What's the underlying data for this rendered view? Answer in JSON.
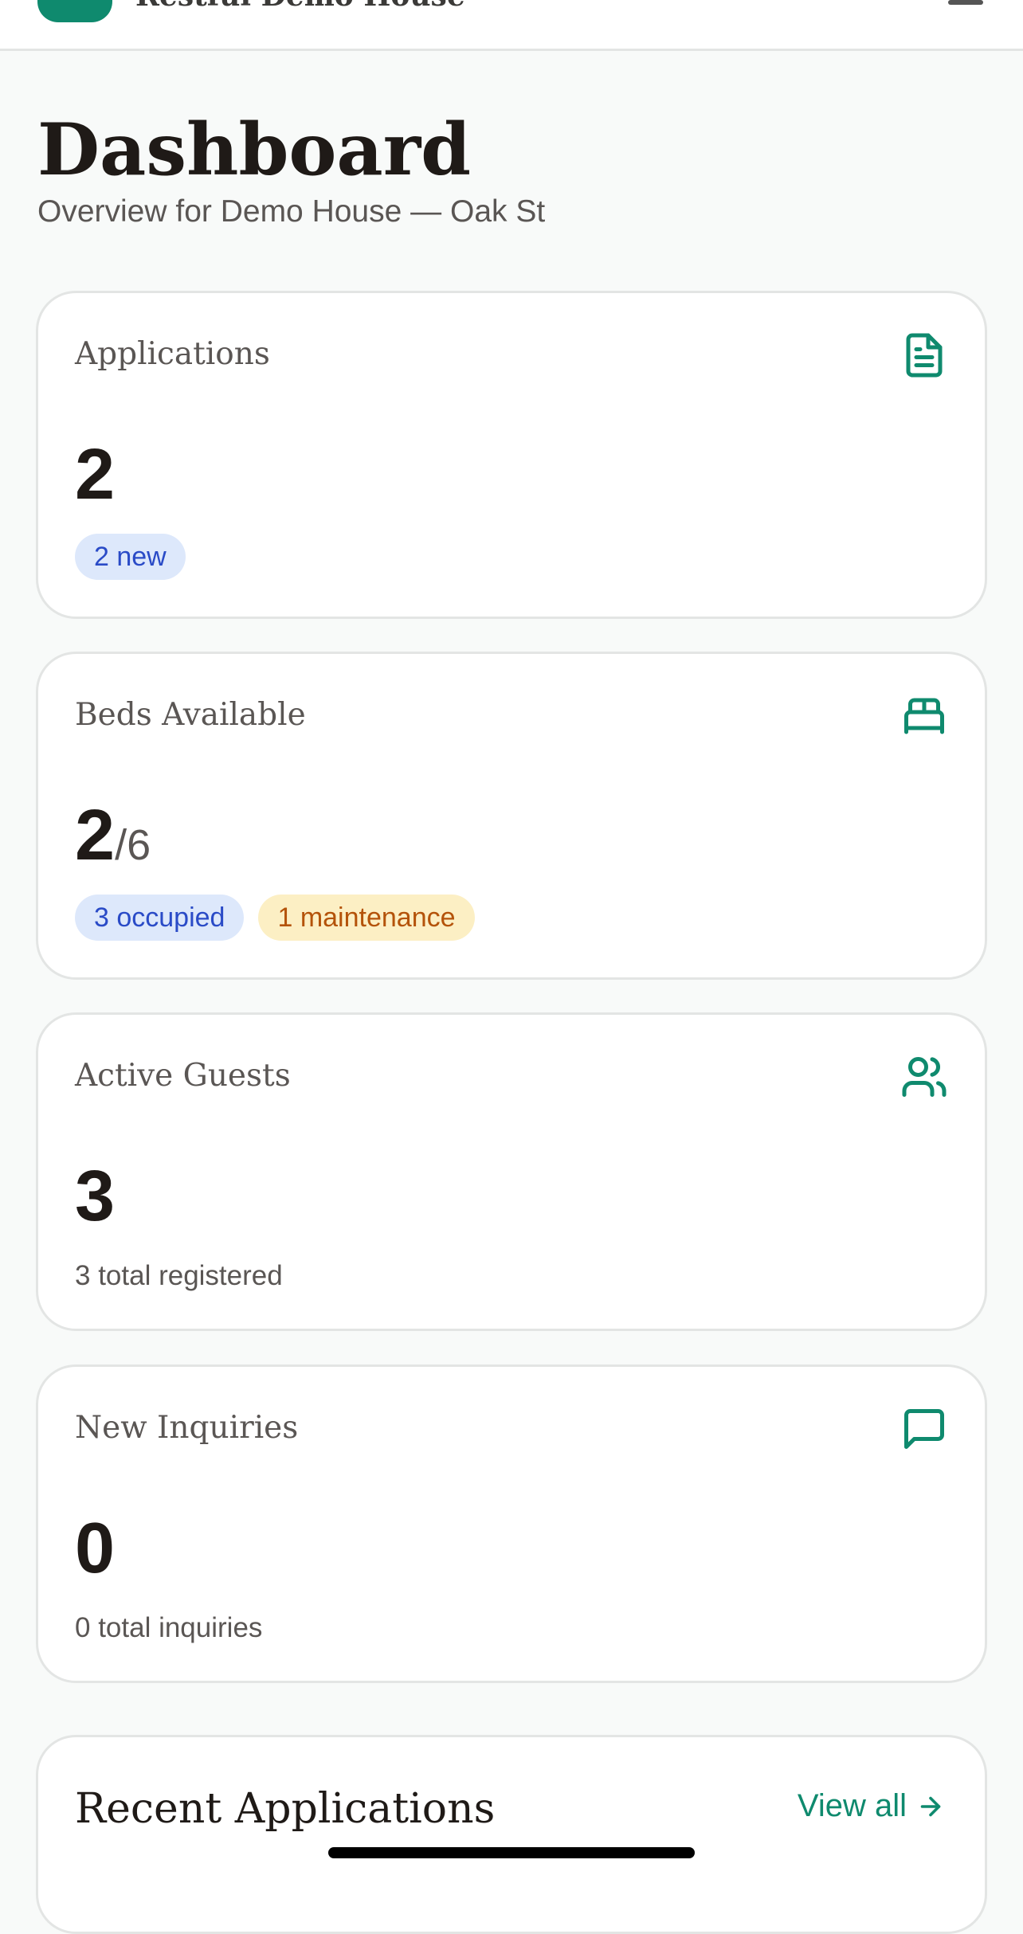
{
  "header": {
    "brand_name": "Restful Demo House",
    "logo_icon": "house-logo-icon",
    "menu_icon": "menu-icon"
  },
  "page": {
    "title": "Dashboard",
    "subtitle": "Overview for Demo House — Oak St"
  },
  "colors": {
    "accent": "#0f8a6e",
    "badge_blue_bg": "#dde8fb",
    "badge_blue_text": "#2a4bc7",
    "badge_amber_bg": "#fcefc4",
    "badge_amber_text": "#b4530a"
  },
  "cards": {
    "applications": {
      "label": "Applications",
      "icon": "document-icon",
      "value": "2",
      "badge_new": "2 new"
    },
    "beds": {
      "label": "Beds Available",
      "icon": "bed-icon",
      "value": "2",
      "total": "/6",
      "badge_occupied": "3 occupied",
      "badge_maintenance": "1 maintenance"
    },
    "guests": {
      "label": "Active Guests",
      "icon": "users-icon",
      "value": "3",
      "note": "3 total registered"
    },
    "inquiries": {
      "label": "New Inquiries",
      "icon": "message-icon",
      "value": "0",
      "note": "0 total inquiries"
    }
  },
  "recent": {
    "title": "Recent Applications",
    "view_all": "View all",
    "view_all_icon": "arrow-right-icon"
  }
}
